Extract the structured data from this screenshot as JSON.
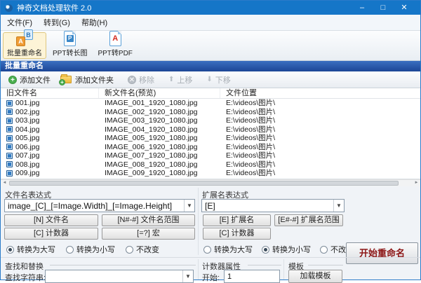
{
  "colors": {
    "titlebar_blue": "#1576c8",
    "section_header_gradient": [
      "#3a6fc0",
      "#1c4696"
    ],
    "toolbar_active_bg": "#fdf4d7",
    "start_button_text": "#8c1515",
    "add_icon_green": "#4aae4f",
    "folder_yellow": "#f0b93a",
    "disabled_gray": "#a8aeb5",
    "file_icon_blue": "#2f79c2"
  },
  "icons": {
    "minimize": "–",
    "maximize": "□",
    "close": "✕",
    "dropdown": "▼",
    "scroll_left": "◄",
    "scroll_right": "►",
    "plus": "+",
    "cross": "✕",
    "up_arrow": "⬆",
    "down_arrow": "⬇"
  },
  "window": {
    "title": "神奇文档处理软件 2.0"
  },
  "menu": {
    "items": [
      "文件(F)",
      "转到(G)",
      "帮助(H)"
    ]
  },
  "toolbar": {
    "items": [
      {
        "label": "批量重命名",
        "letter_a": "A",
        "letter_b": "B"
      },
      {
        "label": "PPT转长图",
        "glyph": "P"
      },
      {
        "label": "PPT转PDF",
        "glyph": "A"
      }
    ]
  },
  "section_header": {
    "title": "批量重命名"
  },
  "action_bar": {
    "add_file": "添加文件",
    "add_folder": "添加文件夹",
    "remove": "移除",
    "move_up": "上移",
    "move_down": "下移"
  },
  "file_table": {
    "columns": [
      "旧文件名",
      "新文件名(预览)",
      "文件位置"
    ],
    "rows": [
      {
        "old": "001.jpg",
        "new": "IMAGE_001_1920_1080.jpg",
        "path": "E:\\videos\\图片\\"
      },
      {
        "old": "002.jpg",
        "new": "IMAGE_002_1920_1080.jpg",
        "path": "E:\\videos\\图片\\"
      },
      {
        "old": "003.jpg",
        "new": "IMAGE_003_1920_1080.jpg",
        "path": "E:\\videos\\图片\\"
      },
      {
        "old": "004.jpg",
        "new": "IMAGE_004_1920_1080.jpg",
        "path": "E:\\videos\\图片\\"
      },
      {
        "old": "005.jpg",
        "new": "IMAGE_005_1920_1080.jpg",
        "path": "E:\\videos\\图片\\"
      },
      {
        "old": "006.jpg",
        "new": "IMAGE_006_1920_1080.jpg",
        "path": "E:\\videos\\图片\\"
      },
      {
        "old": "007.jpg",
        "new": "IMAGE_007_1920_1080.jpg",
        "path": "E:\\videos\\图片\\"
      },
      {
        "old": "008.jpg",
        "new": "IMAGE_008_1920_1080.jpg",
        "path": "E:\\videos\\图片\\"
      },
      {
        "old": "009.jpg",
        "new": "IMAGE_009_1920_1080.jpg",
        "path": "E:\\videos\\图片\\"
      }
    ]
  },
  "filename_expr": {
    "label": "文件名表达式",
    "value": "image_[C]_[=Image.Width]_[=Image.Height]",
    "buttons": [
      "[N] 文件名",
      "[N#-#] 文件名范围",
      "[C] 计数器",
      "[=?] 宏"
    ],
    "case_options": [
      {
        "label": "转换为大写",
        "checked": true
      },
      {
        "label": "转换为小写",
        "checked": false
      },
      {
        "label": "不改变",
        "checked": false
      }
    ]
  },
  "extension_expr": {
    "label": "扩展名表达式",
    "value": "[E]",
    "buttons": [
      "[E] 扩展名",
      "[E#-#] 扩展名范围",
      "[C] 计数器"
    ],
    "case_options": [
      {
        "label": "转换为大写",
        "checked": false
      },
      {
        "label": "转换为小写",
        "checked": true
      },
      {
        "label": "不改变",
        "checked": false
      }
    ]
  },
  "find_replace": {
    "title": "查找和替换",
    "find_label": "查找字符串:",
    "find_value": ""
  },
  "counter": {
    "title": "计数器属性",
    "start_label": "开始:",
    "start_value": "1"
  },
  "template_group": {
    "title": "模板",
    "load_button": "加载模板"
  },
  "start_button": {
    "label": "开始重命名"
  }
}
